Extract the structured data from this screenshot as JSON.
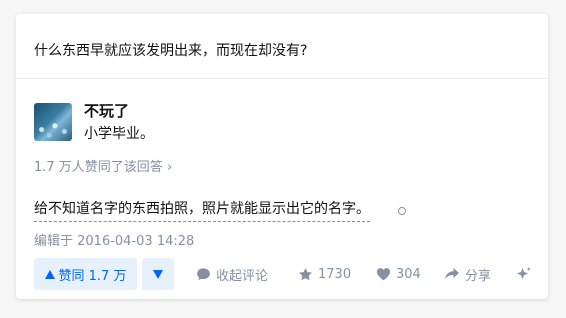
{
  "question": {
    "title": "什么东西早就应该发明出来，而现在却没有?"
  },
  "author": {
    "name": "不玩了",
    "bio": "小学毕业。"
  },
  "voters_text": "1.7 万人赞同了该回答 ›",
  "answer": {
    "content": "给不知道名字的东西拍照，照片就能显示出它的名字。",
    "edited": "编辑于 2016-04-03 14:28"
  },
  "actions": {
    "vote_up": "赞同 1.7 万",
    "comment": "收起评论",
    "favorite_count": "1730",
    "like_count": "304",
    "share": "分享"
  },
  "colors": {
    "accent": "#0066ff",
    "muted": "#8590a6",
    "vote_bg": "#e7f0fd"
  },
  "icons": [
    "triangle-up-icon",
    "triangle-down-icon",
    "comment-icon",
    "star-icon",
    "heart-icon",
    "share-arrow-icon",
    "sparkle-icon"
  ]
}
